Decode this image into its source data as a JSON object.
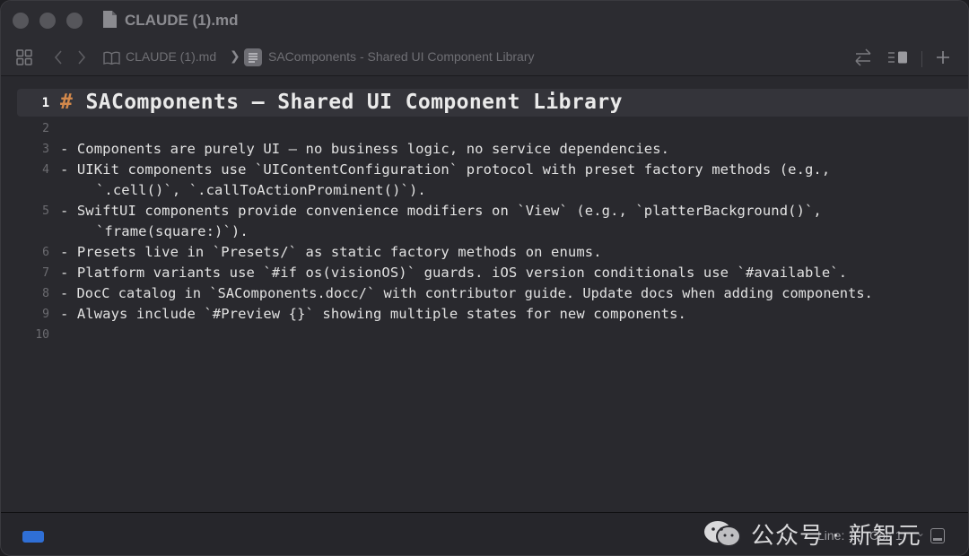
{
  "window": {
    "title": "CLAUDE (1).md"
  },
  "toolbar": {
    "icons": [
      "grid-icon",
      "chevron-left-icon",
      "chevron-right-icon",
      "book-icon",
      "markdown-icon",
      "swap-icon",
      "inspector-icon",
      "plus-icon"
    ],
    "breadcrumb": [
      "CLAUDE (1).md",
      "SAComponents - Shared UI Component Library"
    ],
    "separator": "❯"
  },
  "editor": {
    "current_line": 1,
    "lines": [
      {
        "n": "1",
        "hash": "#",
        "text": " SAComponents — Shared UI Component Library"
      },
      {
        "n": "2",
        "text": ""
      },
      {
        "n": "3",
        "text": "- Components are purely UI — no business logic, no service dependencies."
      },
      {
        "n": "4",
        "text": "- UIKit components use `UIContentConfiguration` protocol with preset factory methods (e.g.,",
        "cont": "`.cell()`, `.callToActionProminent()`)."
      },
      {
        "n": "5",
        "text": "- SwiftUI components provide convenience modifiers on `View` (e.g., `platterBackground()`,",
        "cont": "`frame(square:)`)."
      },
      {
        "n": "6",
        "text": "- Presets live in `Presets/` as static factory methods on enums."
      },
      {
        "n": "7",
        "text": "- Platform variants use `#if os(visionOS)` guards. iOS version conditionals use `#available`."
      },
      {
        "n": "8",
        "text": "- DocC catalog in `SAComponents.docc/` with contributor guide. Update docs when adding components."
      },
      {
        "n": "9",
        "text": "- Always include `#Preview {}` showing multiple states for new components."
      },
      {
        "n": "10",
        "text": ""
      }
    ]
  },
  "statusbar": {
    "line": "Line: 1",
    "col": "Col: 1",
    "chevron": "⌄",
    "watermark": "公众号 · 新智元"
  },
  "colors": {
    "accent_blue": "#2f6fd6",
    "heading_hash": "#d2884b",
    "background": "#29292e"
  }
}
